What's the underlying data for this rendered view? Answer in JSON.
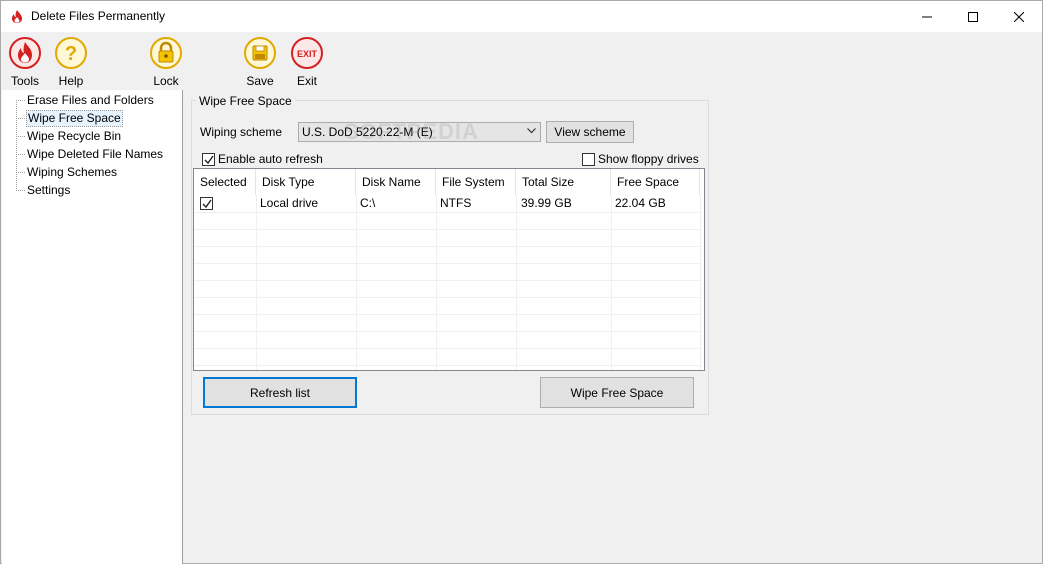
{
  "window": {
    "title": "Delete Files Permanently"
  },
  "toolbar": {
    "tools_label": "Tools",
    "help_label": "Help",
    "lock_label": "Lock",
    "save_label": "Save",
    "exit_label": "Exit"
  },
  "tree": {
    "items": [
      {
        "label": "Erase Files and Folders"
      },
      {
        "label": "Wipe Free Space"
      },
      {
        "label": "Wipe Recycle Bin"
      },
      {
        "label": "Wipe Deleted File Names"
      },
      {
        "label": "Wiping Schemes"
      },
      {
        "label": "Settings"
      }
    ],
    "selected": "Wipe Free Space"
  },
  "panel": {
    "group_title": "Wipe Free Space",
    "wiping_scheme_label": "Wiping scheme",
    "wiping_scheme_value": "U.S. DoD 5220.22-M (E)",
    "view_scheme_label": "View scheme",
    "auto_refresh_label": "Enable auto refresh",
    "auto_refresh_checked": true,
    "floppy_label": "Show floppy drives",
    "floppy_checked": false,
    "refresh_label": "Refresh list",
    "wipe_label": "Wipe Free Space"
  },
  "drives_table": {
    "columns": [
      "Selected",
      "Disk Type",
      "Disk Name",
      "File System",
      "Total Size",
      "Free Space"
    ],
    "rows": [
      {
        "selected": true,
        "disk_type": "Local drive",
        "disk_name": "C:\\",
        "file_system": "NTFS",
        "total_size": "39.99 GB",
        "free_space": "22.04 GB"
      }
    ]
  },
  "watermark": "SOFTPEDIA",
  "colors": {
    "icon_red": "#d42020",
    "icon_yellow": "#f5c400",
    "focus_blue": "#0078d7"
  }
}
